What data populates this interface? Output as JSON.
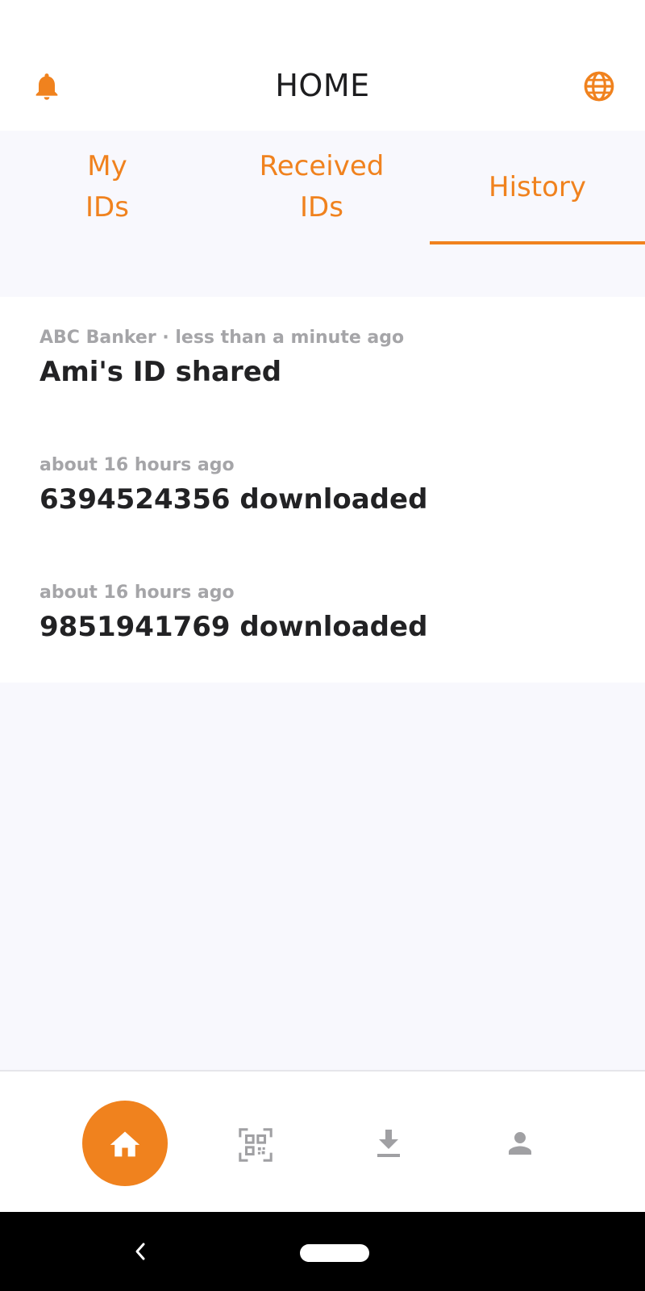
{
  "header": {
    "title": "HOME",
    "left_icon": "bell-icon",
    "right_icon": "globe-icon"
  },
  "tabs": [
    {
      "line1": "My",
      "line2": "IDs",
      "selected": false
    },
    {
      "line1": "Received",
      "line2": "IDs",
      "selected": false
    },
    {
      "line1": "History",
      "line2": "",
      "selected": true
    }
  ],
  "history": [
    {
      "meta": "ABC Banker · less than a minute ago",
      "text": "Ami's ID shared"
    },
    {
      "meta": "about 16 hours ago",
      "text": "6394524356 downloaded"
    },
    {
      "meta": "about 16 hours ago",
      "text": "9851941769 downloaded"
    }
  ],
  "bottom_nav": [
    {
      "icon": "home-icon",
      "active": true
    },
    {
      "icon": "qr-code-icon",
      "active": false
    },
    {
      "icon": "download-icon",
      "active": false
    },
    {
      "icon": "profile-icon",
      "active": false
    }
  ],
  "colors": {
    "accent": "#f0821e",
    "inactive_icon": "#a0a0a3",
    "background": "#f8f8fd"
  }
}
